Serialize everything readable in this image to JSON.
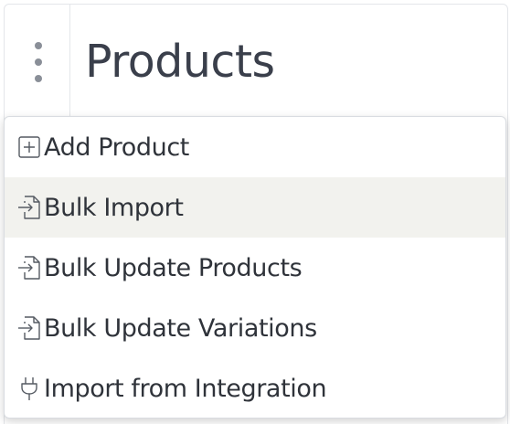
{
  "header": {
    "title": "Products",
    "menu_icon": "kebab-vertical-icon"
  },
  "menu": {
    "items": [
      {
        "label": "Add Product",
        "icon": "plus-square-icon",
        "active": false
      },
      {
        "label": "Bulk Import",
        "icon": "file-import-icon",
        "active": true
      },
      {
        "label": "Bulk Update Products",
        "icon": "file-import-icon",
        "active": false
      },
      {
        "label": "Bulk Update Variations",
        "icon": "file-import-icon",
        "active": false
      },
      {
        "label": "Import from Integration",
        "icon": "plug-icon",
        "active": false
      }
    ]
  },
  "colors": {
    "title": "#3a3f4b",
    "menu_text": "#2f333a",
    "hover_bg": "#f2f2ee",
    "icon": "#555a62",
    "kebab": "#8a8f98"
  }
}
